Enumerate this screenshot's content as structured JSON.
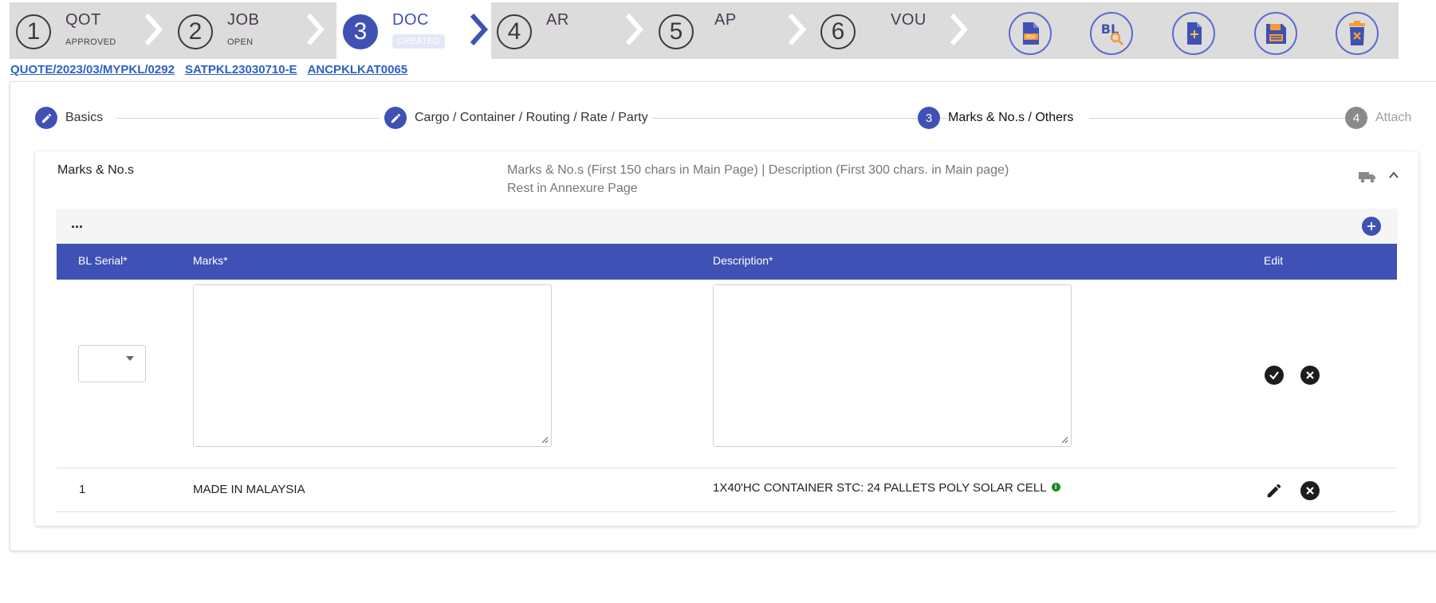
{
  "workflow": {
    "stages": [
      {
        "number": "1",
        "code": "QOT",
        "status": "APPROVED"
      },
      {
        "number": "2",
        "code": "JOB",
        "status": "OPEN"
      },
      {
        "number": "3",
        "code": "DOC",
        "status": "CREATED"
      },
      {
        "number": "4",
        "code": "AR",
        "status": ""
      },
      {
        "number": "5",
        "code": "AP",
        "status": ""
      },
      {
        "number": "6",
        "code": "VOU",
        "status": ""
      }
    ],
    "actions": [
      {
        "icon": "pdf-file-icon",
        "text": "PDF"
      },
      {
        "icon": "bl-preview-icon",
        "text": "BL"
      },
      {
        "icon": "add-document-icon",
        "text": ""
      },
      {
        "icon": "save-icon",
        "text": ""
      },
      {
        "icon": "delete-icon",
        "text": ""
      }
    ],
    "accent_color": "#3f51b5"
  },
  "breadcrumbs": [
    "QUOTE/2023/03/MYPKL/0292",
    "SATPKL23030710-E",
    "ANCPKLKAT0065"
  ],
  "stepper": {
    "steps": [
      {
        "marker": "edit-icon",
        "label": "Basics"
      },
      {
        "marker": "edit-icon",
        "label": "Cargo / Container / Routing / Rate / Party"
      },
      {
        "marker": "3",
        "label": "Marks & No.s / Others"
      },
      {
        "marker": "4",
        "label": "Attach"
      }
    ]
  },
  "marks_section": {
    "title": "Marks & No.s",
    "hint_line1": "Marks & No.s (First 150 chars in Main Page) | Description (First 300 chars. in Main page)",
    "hint_line2": "Rest in Annexure Page",
    "toolbar_label": "...",
    "table": {
      "columns": [
        "BL Serial*",
        "Marks*",
        "Description*",
        "Edit"
      ],
      "edit_row": {
        "bl_serial": "",
        "marks": "",
        "description": ""
      },
      "rows": [
        {
          "bl_serial": "1",
          "marks": "MADE IN MALAYSIA",
          "description": "1X40'HC CONTAINER STC: 24 PALLETS POLY SOLAR CELL"
        }
      ]
    }
  }
}
